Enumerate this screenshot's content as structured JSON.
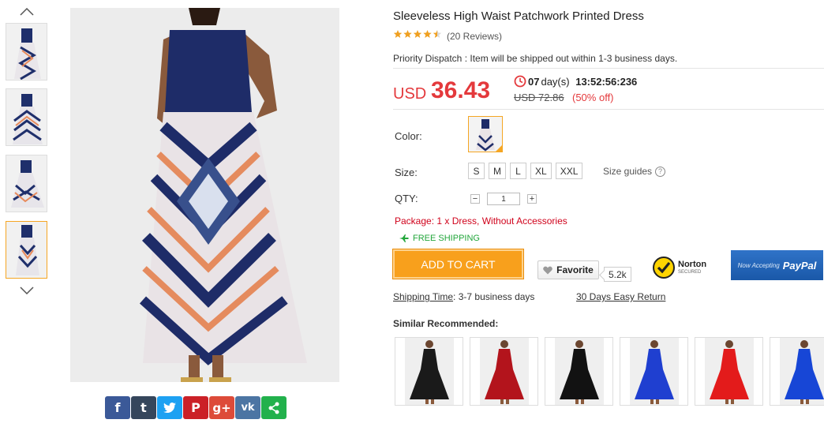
{
  "product": {
    "title": "Sleeveless High Waist Patchwork Printed Dress",
    "rating": 4.5,
    "reviews": "(20 Reviews)",
    "dispatch": "Priority Dispatch : Item will be shipped out within 1-3 business days."
  },
  "price": {
    "currency": "USD",
    "value": "36.43",
    "old": "USD 72.86",
    "discount": "(50% off)",
    "countdown_days": "07",
    "countdown_days_label": "day(s)",
    "countdown_time": "13:52:56:236"
  },
  "options": {
    "color_label": "Color:",
    "size_label": "Size:",
    "sizes": [
      "S",
      "M",
      "L",
      "XL",
      "XXL"
    ],
    "size_guide": "Size guides",
    "size_guide_icon": "?",
    "qty_label": "QTY:",
    "qty_value": "1",
    "qty_minus": "−",
    "qty_plus": "+"
  },
  "package": "Package: 1 x Dress, Without Accessories",
  "free_shipping": "FREE SHIPPING",
  "actions": {
    "add_to_cart": "ADD TO CART",
    "favorite": "Favorite",
    "favorite_count": "5.2k"
  },
  "badges": {
    "norton_name": "Norton",
    "norton_sub": "SECURED",
    "paypal_prefix": "Now Accepting",
    "paypal_brand": "PayPal"
  },
  "links": {
    "shipping_time_label": "Shipping Time",
    "shipping_time_value": ": 3-7 business days",
    "returns": "30 Days Easy Return"
  },
  "similar": {
    "title": "Similar Recommended:",
    "items": [
      {
        "color": "#1a1a1a"
      },
      {
        "color": "#b3141c"
      },
      {
        "color": "#121212"
      },
      {
        "color": "#1f3fd0"
      },
      {
        "color": "#e31b1b"
      },
      {
        "color": "#1746d6"
      }
    ]
  },
  "share": [
    {
      "icon": "facebook-icon",
      "glyph": "f",
      "color": "#3b5998"
    },
    {
      "icon": "tumblr-icon",
      "glyph": "t",
      "color": "#35465c"
    },
    {
      "icon": "twitter-icon",
      "glyph": "🐦",
      "color": "#1da1f2"
    },
    {
      "icon": "pinterest-icon",
      "glyph": "P",
      "color": "#cb2027"
    },
    {
      "icon": "google-plus-icon",
      "glyph": "g+",
      "color": "#dd4b39"
    },
    {
      "icon": "vk-icon",
      "glyph": "vk",
      "color": "#4c75a3"
    },
    {
      "icon": "share-icon",
      "glyph": "⋖",
      "color": "#22b14c"
    }
  ],
  "colors": {
    "accent": "#f8a01c",
    "price": "#e4393c",
    "dress_navy": "#1f2f6b",
    "shipping_green": "#22a63b"
  }
}
